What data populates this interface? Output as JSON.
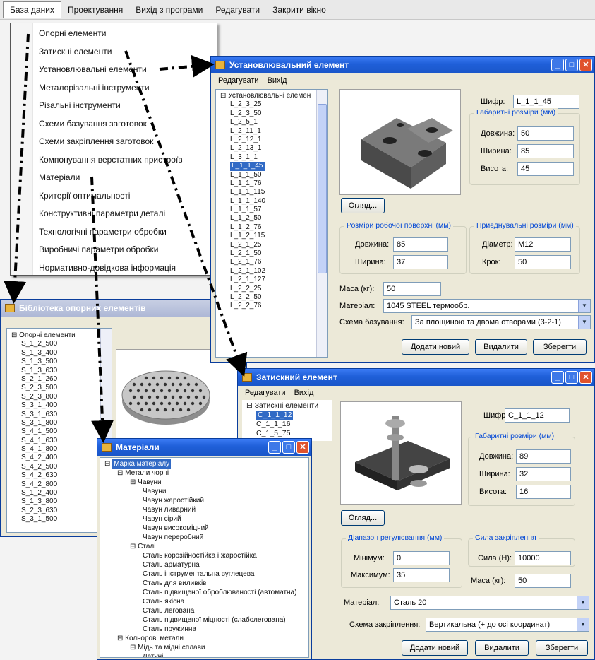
{
  "main_menu": [
    "База даних",
    "Проектування",
    "Вихід з програми",
    "Редагувати",
    "Закрити вікно"
  ],
  "database_menu": [
    "Опорні елементи",
    "Затискні елементи",
    "Установлювальні елементи",
    "Металорізальні інструменти",
    "Різальні інструменти",
    "Схеми базування заготовок",
    "Схеми закріплення заготовок",
    "Компонування верстатних пристроїв",
    "Матеріали",
    "Критерії оптимальності",
    "Конструктивні параметри деталі",
    "Технологічні параметри обробки",
    "Виробничі параметри обробки",
    "Нормативно-довідкова інформація"
  ],
  "support_win": {
    "title": "Бібліотека опорних елементів",
    "tree": [
      "Опорні елементи",
      "S_1_2_500",
      "S_1_3_400",
      "S_1_3_500",
      "S_1_3_630",
      "S_2_1_260",
      "S_2_3_500",
      "S_2_3_800",
      "S_3_1_400",
      "S_3_1_630",
      "S_3_1_800",
      "S_4_1_500",
      "S_4_1_630",
      "S_4_1_800",
      "S_4_2_400",
      "S_4_2_500",
      "S_4_2_630",
      "S_4_2_800",
      "S_1_2_400",
      "S_1_3_800",
      "S_2_3_630",
      "S_3_1_500"
    ]
  },
  "install_win": {
    "title": "Установлювальний елемент",
    "menu": [
      "Редагувати",
      "Вихід"
    ],
    "tree": [
      "Установлювальні елемен",
      "L_2_3_25",
      "L_2_3_50",
      "L_2_5_1",
      "L_2_11_1",
      "L_2_12_1",
      "L_2_13_1",
      "L_3_1_1",
      "L_1_1_45",
      "L_1_1_50",
      "L_1_1_76",
      "L_1_1_115",
      "L_1_1_140",
      "L_1_1_57",
      "L_1_2_50",
      "L_1_2_76",
      "L_1_2_115",
      "L_2_1_25",
      "L_2_1_50",
      "L_2_1_76",
      "L_2_1_102",
      "L_2_1_127",
      "L_2_2_25",
      "L_2_2_50",
      "L_2_2_76"
    ],
    "selected_index": 8,
    "cipher_label": "Шифр:",
    "cipher": "L_1_1_45",
    "dims_title": "Габаритні розміри (мм)",
    "length_label": "Довжина:",
    "length": "50",
    "width_label": "Ширина:",
    "width": "85",
    "height_label": "Висота:",
    "height": "45",
    "view_btn": "Огляд...",
    "work_title": "Розміри робочої поверхні (мм)",
    "work_length_label": "Довжина:",
    "work_length": "85",
    "work_width_label": "Ширина:",
    "work_width": "37",
    "mount_title": "Приєднувальні розміри (мм)",
    "diameter_label": "Діаметр:",
    "diameter": "M12",
    "pitch_label": "Крок:",
    "pitch": "50",
    "mass_label": "Маса (кг):",
    "mass": "50",
    "material_label": "Матеріал:",
    "material": "1045 STEEL термообр.",
    "scheme_label": "Схема базування:",
    "scheme": "За площиною та двома отворами (3-2-1)",
    "add_btn": "Додати новий",
    "delete_btn": "Видалити",
    "save_btn": "Зберегти"
  },
  "clamp_win": {
    "title": "Затискний елемент",
    "menu": [
      "Редагувати",
      "Вихід"
    ],
    "tree": [
      "Затискні елементи",
      "C_1_1_12",
      "C_1_1_16",
      "C_1_5_75"
    ],
    "selected_index": 1,
    "cipher_label": "Шифр:",
    "cipher": "C_1_1_12",
    "dims_title": "Габаритні розміри (мм)",
    "length_label": "Довжина:",
    "length": "89",
    "width_label": "Ширина:",
    "width": "32",
    "height_label": "Висота:",
    "height": "16",
    "view_btn": "Огляд...",
    "range_title": "Діапазон регулювання (мм)",
    "min_label": "Мінімум:",
    "min": "0",
    "max_label": "Максимум:",
    "max": "35",
    "force_title": "Сила закріплення",
    "force_label": "Сила (Н):",
    "force": "10000",
    "mass_label": "Маса (кг):",
    "mass": "50",
    "material_label": "Матеріал:",
    "material": "Сталь 20",
    "scheme_label": "Схема закріплення:",
    "scheme": "Вертикальна (+ до осі координат)",
    "add_btn": "Додати новий",
    "delete_btn": "Видалити",
    "save_btn": "Зберегти"
  },
  "materials_win": {
    "title": "Матеріали",
    "tree": [
      {
        "t": "Марка матеріалу",
        "d": 0,
        "sel": true
      },
      {
        "t": "Метали чорні",
        "d": 1
      },
      {
        "t": "Чавуни",
        "d": 2
      },
      {
        "t": "Чавуни",
        "d": 3
      },
      {
        "t": "Чавун жаростійкий",
        "d": 3
      },
      {
        "t": "Чавун ливарний",
        "d": 3
      },
      {
        "t": "Чавун сірий",
        "d": 3
      },
      {
        "t": "Чавун високоміцний",
        "d": 3
      },
      {
        "t": "Чавун переробний",
        "d": 3
      },
      {
        "t": "Сталі",
        "d": 2
      },
      {
        "t": "Сталь корозійностійка і жаростійка",
        "d": 3
      },
      {
        "t": "Сталь арматурна",
        "d": 3
      },
      {
        "t": "Сталь інструментальна вуглецева",
        "d": 3
      },
      {
        "t": "Сталь для виливків",
        "d": 3
      },
      {
        "t": "Сталь підвищеної оброблюваності (автоматна)",
        "d": 3
      },
      {
        "t": "Сталь якісна",
        "d": 3
      },
      {
        "t": "Сталь легована",
        "d": 3
      },
      {
        "t": "Сталь підвищеної міцності (слаболегована)",
        "d": 3
      },
      {
        "t": "Сталь пружинна",
        "d": 3
      },
      {
        "t": "Кольорові метали",
        "d": 1
      },
      {
        "t": "Мідь та мідні сплави",
        "d": 2
      },
      {
        "t": "Латуні",
        "d": 3
      }
    ]
  },
  "colors": {
    "accent": "#316ac5",
    "title_bar": "#1f5fd8",
    "group_title": "#0046d5"
  }
}
